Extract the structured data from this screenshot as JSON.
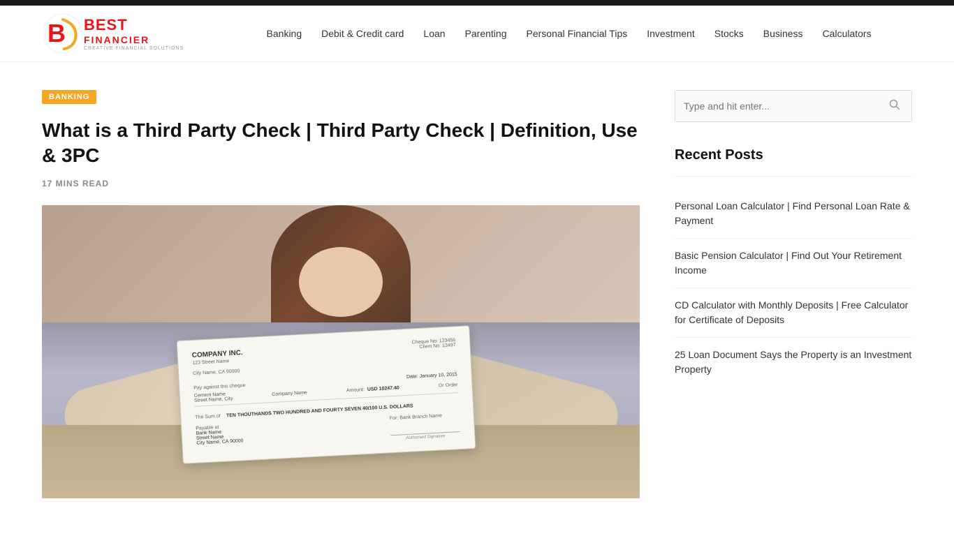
{
  "topbar": {},
  "header": {
    "logo": {
      "best": "BEST",
      "financier": "FINANCIER",
      "tagline": "CREATIVE  FINANCIAL  SOLUTIONS"
    },
    "nav": {
      "items": [
        {
          "label": "Banking",
          "id": "banking"
        },
        {
          "label": "Debit & Credit card",
          "id": "debit-credit"
        },
        {
          "label": "Loan",
          "id": "loan"
        },
        {
          "label": "Parenting",
          "id": "parenting"
        },
        {
          "label": "Personal Financial Tips",
          "id": "personal-financial"
        },
        {
          "label": "Investment",
          "id": "investment"
        },
        {
          "label": "Stocks",
          "id": "stocks"
        },
        {
          "label": "Business",
          "id": "business"
        },
        {
          "label": "Calculators",
          "id": "calculators"
        }
      ]
    }
  },
  "article": {
    "category": "BANKING",
    "title": "What is a Third Party Check | Third Party Check | Definition, Use & 3PC",
    "meta": "17 MINS READ",
    "check": {
      "company": "COMPANY INC.",
      "address1": "123 Street Name",
      "address2": "City Name, CA 90000",
      "date_label": "Date:",
      "date_value": "January 10, 2015",
      "cheque_label": "Cheque No:",
      "cheque_value": "123456",
      "client_label": "Client No:",
      "client_value": "13497",
      "amount_label": "Amount:",
      "amount_value": "USD 10247.40",
      "or_order": "Or Order",
      "pay_against": "Pay against this cheque",
      "cement_name": "Cement Name",
      "company_name": "Company Name",
      "street_city": "Street Name, City",
      "sum_label": "The Sum of",
      "sum_text": "TEN THOUTHANDS TWO HUNDRED AND FOURTY SEVEN 40/100 U.S. DOLLARS",
      "payable_label": "Payable at",
      "bank_name": "Bank Name",
      "street_name": "Street Name",
      "city": "City Name, CA 90000",
      "for_label": "For: Bank Branch Name",
      "sig_label": "Authorised Signature"
    }
  },
  "sidebar": {
    "search": {
      "placeholder": "Type and hit enter..."
    },
    "recent_posts": {
      "title": "Recent Posts",
      "items": [
        {
          "label": "Personal Loan Calculator | Find Personal Loan Rate & Payment"
        },
        {
          "label": "Basic Pension Calculator | Find Out Your Retirement Income"
        },
        {
          "label": "CD Calculator with Monthly Deposits | Free Calculator for Certificate of Deposits"
        },
        {
          "label": "25 Loan Document Says the Property is an Investment Property"
        }
      ]
    }
  }
}
